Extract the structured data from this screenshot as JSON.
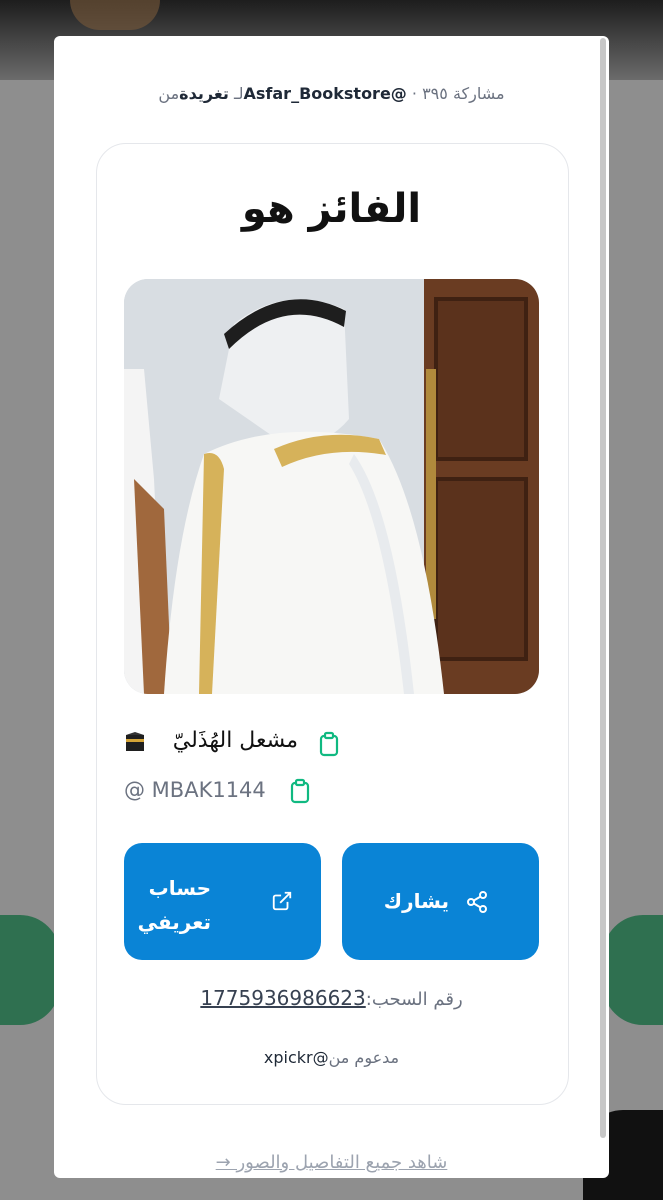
{
  "header": {
    "shares_label": "مشاركة",
    "shares_count": "٣٩٥",
    "tweet_label": "تغريدة",
    "from_label": "من",
    "for_label": "لـ",
    "account": "@Asfar_Bookstore"
  },
  "card": {
    "title": "الفائز هو",
    "winner_name": "مشعل الهُذَليّ",
    "winner_emoji": "🕋",
    "winner_handle": "@ MBAK1144"
  },
  "buttons": {
    "share_label": "يشارك",
    "profile_label": "حساب تعريفي"
  },
  "draw": {
    "label": "رقم السحب:",
    "number": "1775936986623"
  },
  "invited": {
    "label": "مدعوم من",
    "account": "@xpickr"
  },
  "footer": {
    "details_link": "شاهد جميع التفاصيل والصور →"
  },
  "colors": {
    "accent": "#0a84d6",
    "copy_icon": "#10b981"
  }
}
